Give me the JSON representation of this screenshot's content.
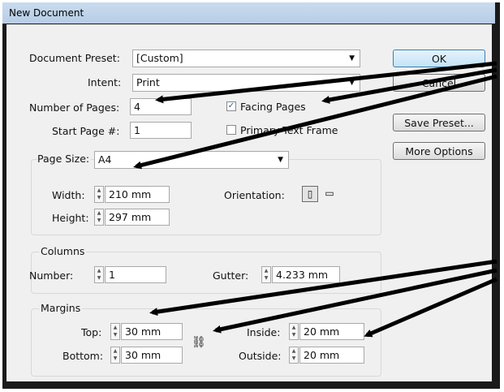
{
  "window": {
    "title": "New Document"
  },
  "preset": {
    "label": "Document Preset:",
    "value": "[Custom]"
  },
  "intent": {
    "label": "Intent:",
    "value": "Print"
  },
  "pages": {
    "label": "Number of Pages:",
    "value": "4"
  },
  "start_page": {
    "label": "Start Page #:",
    "value": "1"
  },
  "facing_pages": {
    "label": "Facing Pages",
    "checked": true
  },
  "primary_text_frame": {
    "label": "Primary Text Frame",
    "checked": false
  },
  "buttons": {
    "ok": "OK",
    "cancel": "Cancel",
    "save_preset": "Save Preset...",
    "more_options": "More Options"
  },
  "page_size": {
    "label": "Page Size:",
    "value": "A4",
    "width_label": "Width:",
    "width": "210 mm",
    "height_label": "Height:",
    "height": "297 mm",
    "orientation_label": "Orientation:"
  },
  "columns": {
    "title": "Columns",
    "number_label": "Number:",
    "number": "1",
    "gutter_label": "Gutter:",
    "gutter": "4.233 mm"
  },
  "margins": {
    "title": "Margins",
    "top_label": "Top:",
    "top": "30 mm",
    "bottom_label": "Bottom:",
    "bottom": "30 mm",
    "inside_label": "Inside:",
    "inside": "20 mm",
    "outside_label": "Outside:",
    "outside": "20 mm"
  },
  "colors": {
    "arrow": "#000000",
    "titlebar": "#c9dcef",
    "ok_border": "#3c7fb1"
  }
}
